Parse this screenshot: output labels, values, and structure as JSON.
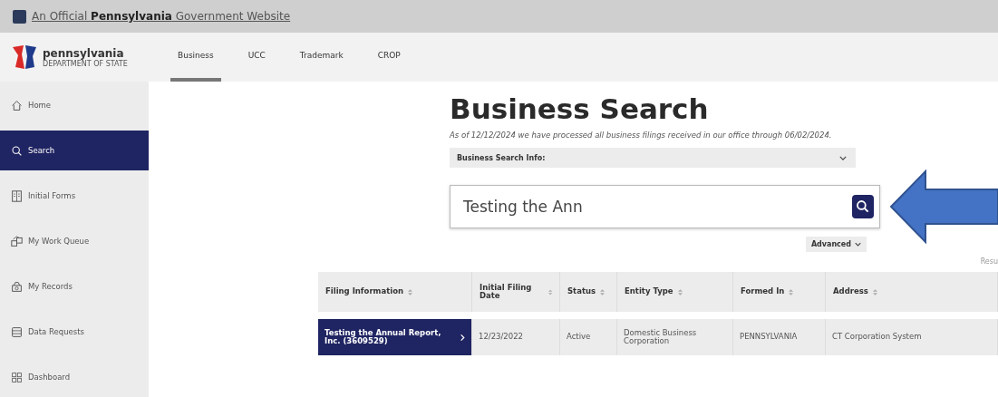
{
  "gov_banner": {
    "text": "An Official **Pennsylvania** Government Website"
  },
  "logo": {
    "name": "pennsylvania",
    "subtitle": "DEPARTMENT OF STATE"
  },
  "tabs": [
    {
      "label": "Business",
      "selected": true
    },
    {
      "label": "UCC",
      "selected": false
    },
    {
      "label": "Trademark",
      "selected": false
    },
    {
      "label": "CROP",
      "selected": false
    }
  ],
  "sidebar": {
    "items": [
      {
        "label": "Home",
        "kind": "home",
        "selected": false
      },
      {
        "label": "Search",
        "kind": "search",
        "selected": true
      },
      {
        "label": "Initial Forms",
        "kind": "forms",
        "selected": false
      },
      {
        "label": "My Work Queue",
        "kind": "queue",
        "selected": false
      },
      {
        "label": "My Records",
        "kind": "records",
        "selected": false
      },
      {
        "label": "Data Requests",
        "kind": "data",
        "selected": false
      },
      {
        "label": "Dashboard",
        "kind": "dashboard",
        "selected": false
      }
    ]
  },
  "page": {
    "title": "Business Search",
    "notice": "As of 12/12/2024 we have processed all business filings received in our office through 06/02/2024.",
    "info_dropdown": "Business Search Info:",
    "search": {
      "value": "Testing the Ann"
    },
    "advanced": "Advanced",
    "results_label": "Resu"
  },
  "table": {
    "columns": [
      "Filing Information",
      "Initial Filing Date",
      "Status",
      "Entity Type",
      "Formed In",
      "Address"
    ],
    "rows": [
      {
        "cells": [
          "Testing the Annual Report, Inc. (3609529)",
          "12/23/2022",
          "Active",
          "Domestic Business Corporation",
          "PENNSYLVANIA",
          "CT Corporation System"
        ]
      }
    ]
  }
}
